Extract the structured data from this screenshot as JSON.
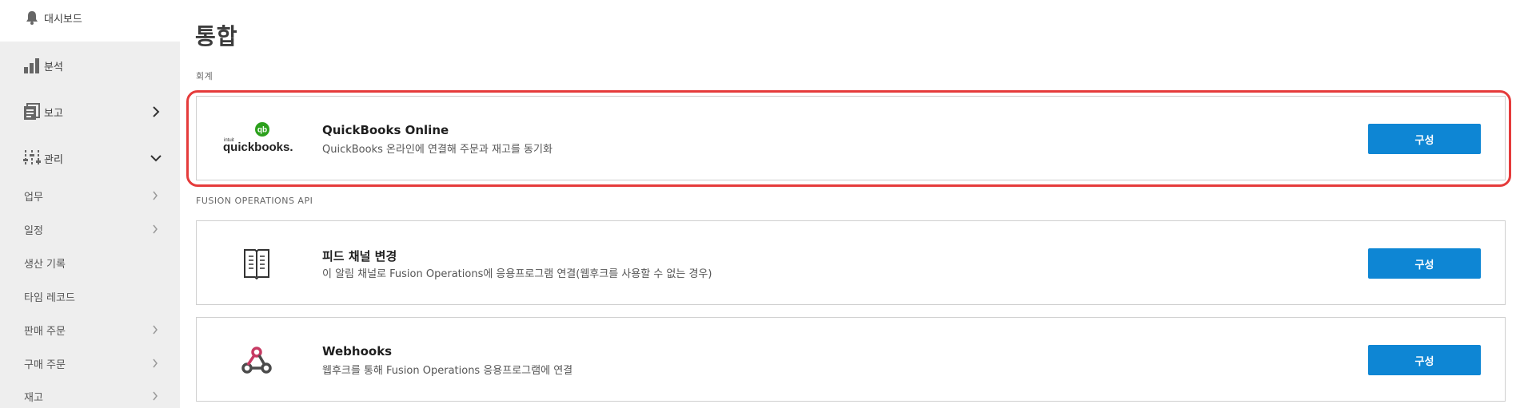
{
  "sidebar": {
    "dashboard": {
      "label": "대시보드",
      "icon": "bell-icon"
    },
    "analysis": {
      "label": "분석",
      "icon": "bar-chart-icon"
    },
    "reports": {
      "label": "보고",
      "icon": "document-stack-icon"
    },
    "manage": {
      "label": "관리",
      "icon": "sliders-icon"
    },
    "sub_items": [
      {
        "label": "업무",
        "has_chevron": true
      },
      {
        "label": "일정",
        "has_chevron": true
      },
      {
        "label": "생산 기록",
        "has_chevron": false
      },
      {
        "label": "타임 레코드",
        "has_chevron": false
      },
      {
        "label": "판매 주문",
        "has_chevron": true
      },
      {
        "label": "구매 주문",
        "has_chevron": true
      },
      {
        "label": "재고",
        "has_chevron": true
      }
    ]
  },
  "main": {
    "title": "통합",
    "sections": [
      {
        "label": "회계",
        "cards": [
          {
            "name": "QuickBooks Online",
            "description": "QuickBooks 온라인에 연결해 주문과 재고를 동기화",
            "button": "구성",
            "logo_text": "quickbooks.",
            "logo_small_text": "intuit",
            "logo_badge": "qb",
            "highlighted": true
          }
        ]
      },
      {
        "label": "FUSION OPERATIONS API",
        "cards": [
          {
            "name": "피드 채널 변경",
            "description": "이 알림 채널로 Fusion Operations에 응용프로그램 연결(웹후크를 사용할 수 없는 경우)",
            "button": "구성",
            "icon": "feed-book-icon"
          },
          {
            "name": "Webhooks",
            "description": "웹후크를 통해 Fusion Operations 응용프로그램에 연결",
            "button": "구성",
            "icon": "webhook-icon"
          }
        ]
      }
    ]
  },
  "colors": {
    "sidebar_bg": "#eeeeee",
    "button_bg": "#0e86d4",
    "highlight": "#e53b3b",
    "quickbooks_green": "#2ca01c"
  }
}
